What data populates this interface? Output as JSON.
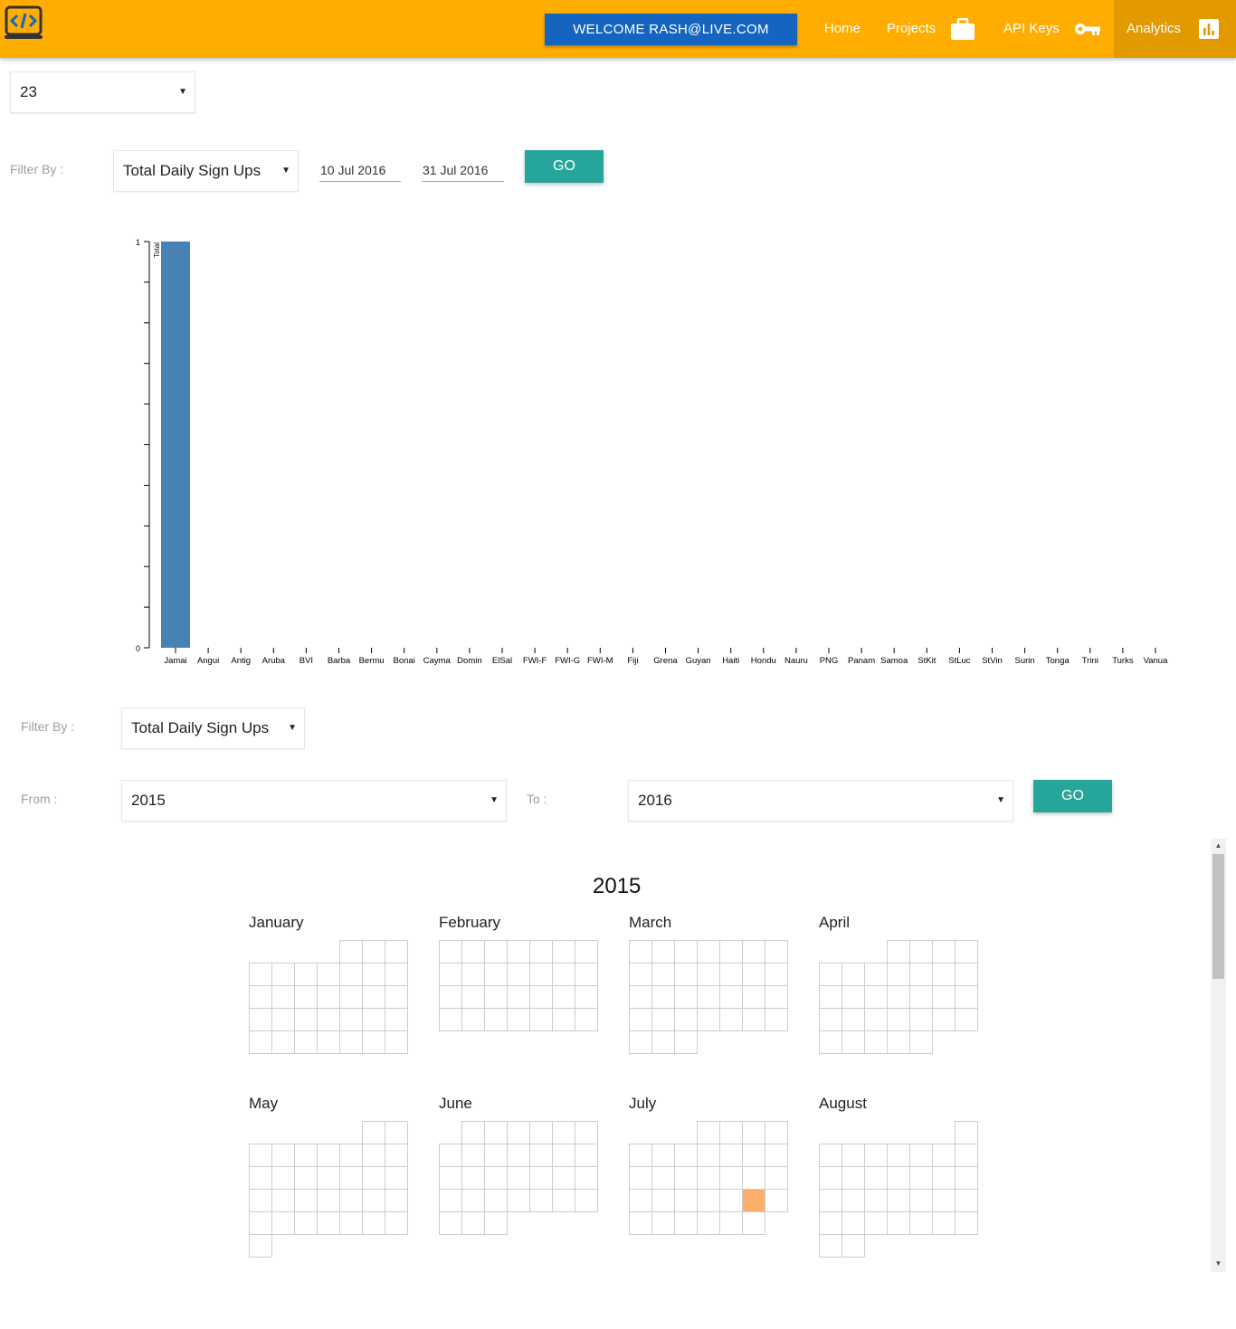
{
  "header": {
    "welcome_label": "WELCOME RASH@LIVE.COM",
    "nav": [
      {
        "label": "Home",
        "icon": "home"
      },
      {
        "label": "Projects",
        "icon": "briefcase-icon"
      },
      {
        "label": "API Keys",
        "icon": "key-icon"
      },
      {
        "label": "Analytics",
        "icon": "bar-chart-icon",
        "active": true
      }
    ],
    "brand_color": "#ffad00",
    "accent_color": "#1565c0"
  },
  "top_select": {
    "value": "23"
  },
  "filter1": {
    "label": "Filter By :",
    "select_value": "Total Daily Sign Ups",
    "start_date": "10 Jul 2016",
    "end_date": "31 Jul 2016",
    "go_label": "GO"
  },
  "chart_data": {
    "type": "bar",
    "categories": [
      "Jamai",
      "Angui",
      "Antig",
      "Aruba",
      "BVI",
      "Barba",
      "Bermu",
      "Bonai",
      "Cayma",
      "Domin",
      "ElSal",
      "FWI-F",
      "FWI-G",
      "FWI-M",
      "Fiji",
      "Grena",
      "Guyan",
      "Haiti",
      "Hondu",
      "Nauru",
      "PNG",
      "Panam",
      "Samoa",
      "StKit",
      "StLuc",
      "StVin",
      "Surin",
      "Tonga",
      "Trini",
      "Turks",
      "Vanua"
    ],
    "series": [
      {
        "name": "Total",
        "values": [
          1,
          0,
          0,
          0,
          0,
          0,
          0,
          0,
          0,
          0,
          0,
          0,
          0,
          0,
          0,
          0,
          0,
          0,
          0,
          0,
          0,
          0,
          0,
          0,
          0,
          0,
          0,
          0,
          0,
          0,
          0
        ]
      }
    ],
    "ylim": [
      0,
      1
    ],
    "ytick_labels": [
      "0",
      "1"
    ],
    "bar_color": "#4682b4"
  },
  "filter2": {
    "label": "Filter By :",
    "select_value": "Total Daily Sign Ups",
    "from_label": "From :",
    "from_value": "2015",
    "to_label": "To :",
    "to_value": "2016",
    "go_label": "GO"
  },
  "calendar": {
    "year": "2015",
    "highlight_color": "#fdae6b",
    "months": [
      {
        "name": "January",
        "start_dow": 4,
        "days": 31
      },
      {
        "name": "February",
        "start_dow": 0,
        "days": 28
      },
      {
        "name": "March",
        "start_dow": 0,
        "days": 31
      },
      {
        "name": "April",
        "start_dow": 3,
        "days": 30
      },
      {
        "name": "May",
        "start_dow": 5,
        "days": 31
      },
      {
        "name": "June",
        "start_dow": 1,
        "days": 30
      },
      {
        "name": "July",
        "start_dow": 3,
        "days": 31,
        "highlight_days": [
          24
        ]
      },
      {
        "name": "August",
        "start_dow": 6,
        "days": 31
      }
    ]
  }
}
